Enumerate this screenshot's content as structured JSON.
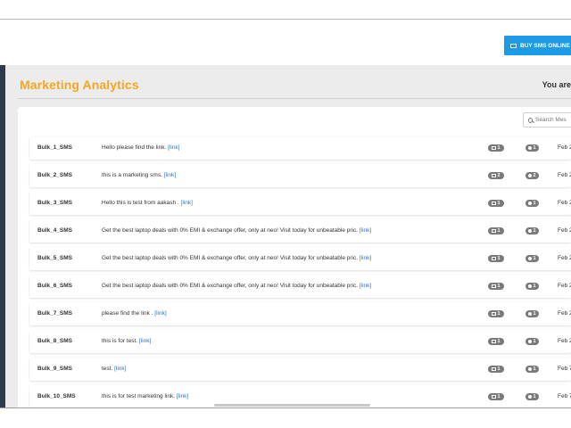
{
  "header": {
    "buy_label": "BUY SMS ONLINE",
    "buy_icon": "card-icon"
  },
  "page": {
    "title": "Marketing Analytics",
    "welcome": "You are",
    "title_color": "#f5a623"
  },
  "search": {
    "placeholder": "Search Mes"
  },
  "colors": {
    "accent_button": "#1e9be6",
    "link": "#2e74c9",
    "badge": "#7a7a7a",
    "rail": "#2d3b4e"
  },
  "rows": [
    {
      "name": "Bulk_1_SMS",
      "message": "Hello please find the link. ",
      "link": "[link]",
      "messages": "1",
      "users": "1",
      "date": "Feb 2"
    },
    {
      "name": "Bulk_2_SMS",
      "message": "this is a marketing sms. ",
      "link": "[link]",
      "messages": "2",
      "users": "2",
      "date": "Feb 2"
    },
    {
      "name": "Bulk_3_SMS",
      "message": "Hello this is test from aakash . ",
      "link": "[link]",
      "messages": "1",
      "users": "1",
      "date": "Feb 2"
    },
    {
      "name": "Bulk_4_SMS",
      "message": "Get the best laptop deals with 0% EMI & exchange offer, only at neo! Visit today for unbeatable pric. ",
      "link": "[link]",
      "messages": "1",
      "users": "1",
      "date": "Feb 2"
    },
    {
      "name": "Bulk_5_SMS",
      "message": "Get the best laptop deals with 0% EMI & exchange offer, only at neo! Visit today for unbeatable pric. ",
      "link": "[link]",
      "messages": "1",
      "users": "1",
      "date": "Feb 2"
    },
    {
      "name": "Bulk_6_SMS",
      "message": "Get the best laptop deals with 0% EMI & exchange offer, only at neo! Visit today for unbeatable pric. ",
      "link": "[link]",
      "messages": "1",
      "users": "1",
      "date": "Feb 2"
    },
    {
      "name": "Bulk_7_SMS",
      "message": "please find the link . ",
      "link": "[link]",
      "messages": "1",
      "users": "1",
      "date": "Feb 2"
    },
    {
      "name": "Bulk_8_SMS",
      "message": "this is for test. ",
      "link": "[link]",
      "messages": "1",
      "users": "1",
      "date": "Feb 2"
    },
    {
      "name": "Bulk_9_SMS",
      "message": "test. ",
      "link": "[link]",
      "messages": "1",
      "users": "1",
      "date": "Feb 7"
    },
    {
      "name": "Bulk_10_SMS",
      "message": "this is for test marketing link. ",
      "link": "[link]",
      "messages": "1",
      "users": "1",
      "date": "Feb 7"
    }
  ]
}
